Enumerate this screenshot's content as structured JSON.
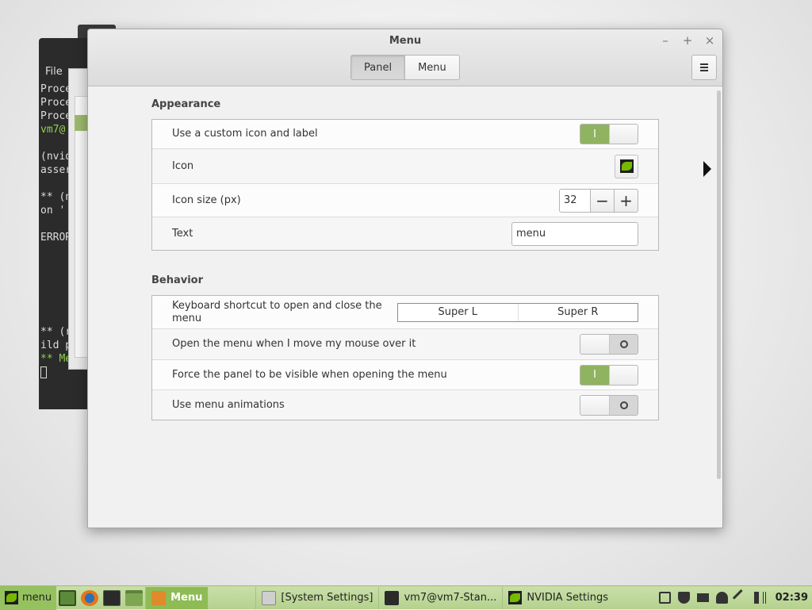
{
  "terminal": {
    "menu_label": "File",
    "lines": [
      "Proce",
      "Proce",
      "Proce",
      "vm7@",
      "",
      "(nvid",
      "asser",
      "",
      "** (n",
      "on '",
      "",
      "ERROR",
      "",
      "",
      "",
      "",
      "",
      "",
      "** (r",
      "ild p",
      "** Me"
    ]
  },
  "window": {
    "title": "Menu",
    "controls": {
      "minimize": "–",
      "maximize": "+",
      "close": "×"
    },
    "tabs": [
      {
        "label": "Panel",
        "active": true
      },
      {
        "label": "Menu",
        "active": false
      }
    ]
  },
  "appearance": {
    "title": "Appearance",
    "custom_icon": {
      "label": "Use a custom icon and label",
      "on_mark": "I",
      "enabled": true
    },
    "icon": {
      "label": "Icon",
      "icon_name": "nvidia-icon"
    },
    "icon_size": {
      "label": "Icon size (px)",
      "value": "32",
      "minus": "−",
      "plus": "+"
    },
    "text": {
      "label": "Text",
      "value": "menu"
    }
  },
  "behavior": {
    "title": "Behavior",
    "shortcut": {
      "label": "Keyboard shortcut to open and close the menu",
      "key1": "Super L",
      "key2": "Super R"
    },
    "hover_open": {
      "label": "Open the menu when I move my mouse over it",
      "enabled": false
    },
    "force_visible": {
      "label": "Force the panel to be visible when opening the menu",
      "on_mark": "I",
      "enabled": true
    },
    "animations": {
      "label": "Use menu animations",
      "enabled": false
    }
  },
  "taskbar": {
    "menu_label": "menu",
    "tasks": [
      {
        "label": "Menu",
        "active": true
      },
      {
        "label": "[System Settings]",
        "active": false
      },
      {
        "label": "vm7@vm7-Stan...",
        "active": false
      },
      {
        "label": "NVIDIA Settings",
        "active": false
      }
    ],
    "clock": "02:39"
  },
  "colors": {
    "accent": "#8fb360",
    "panel": "#b5d18e",
    "window_bg": "#f1f1f1"
  }
}
